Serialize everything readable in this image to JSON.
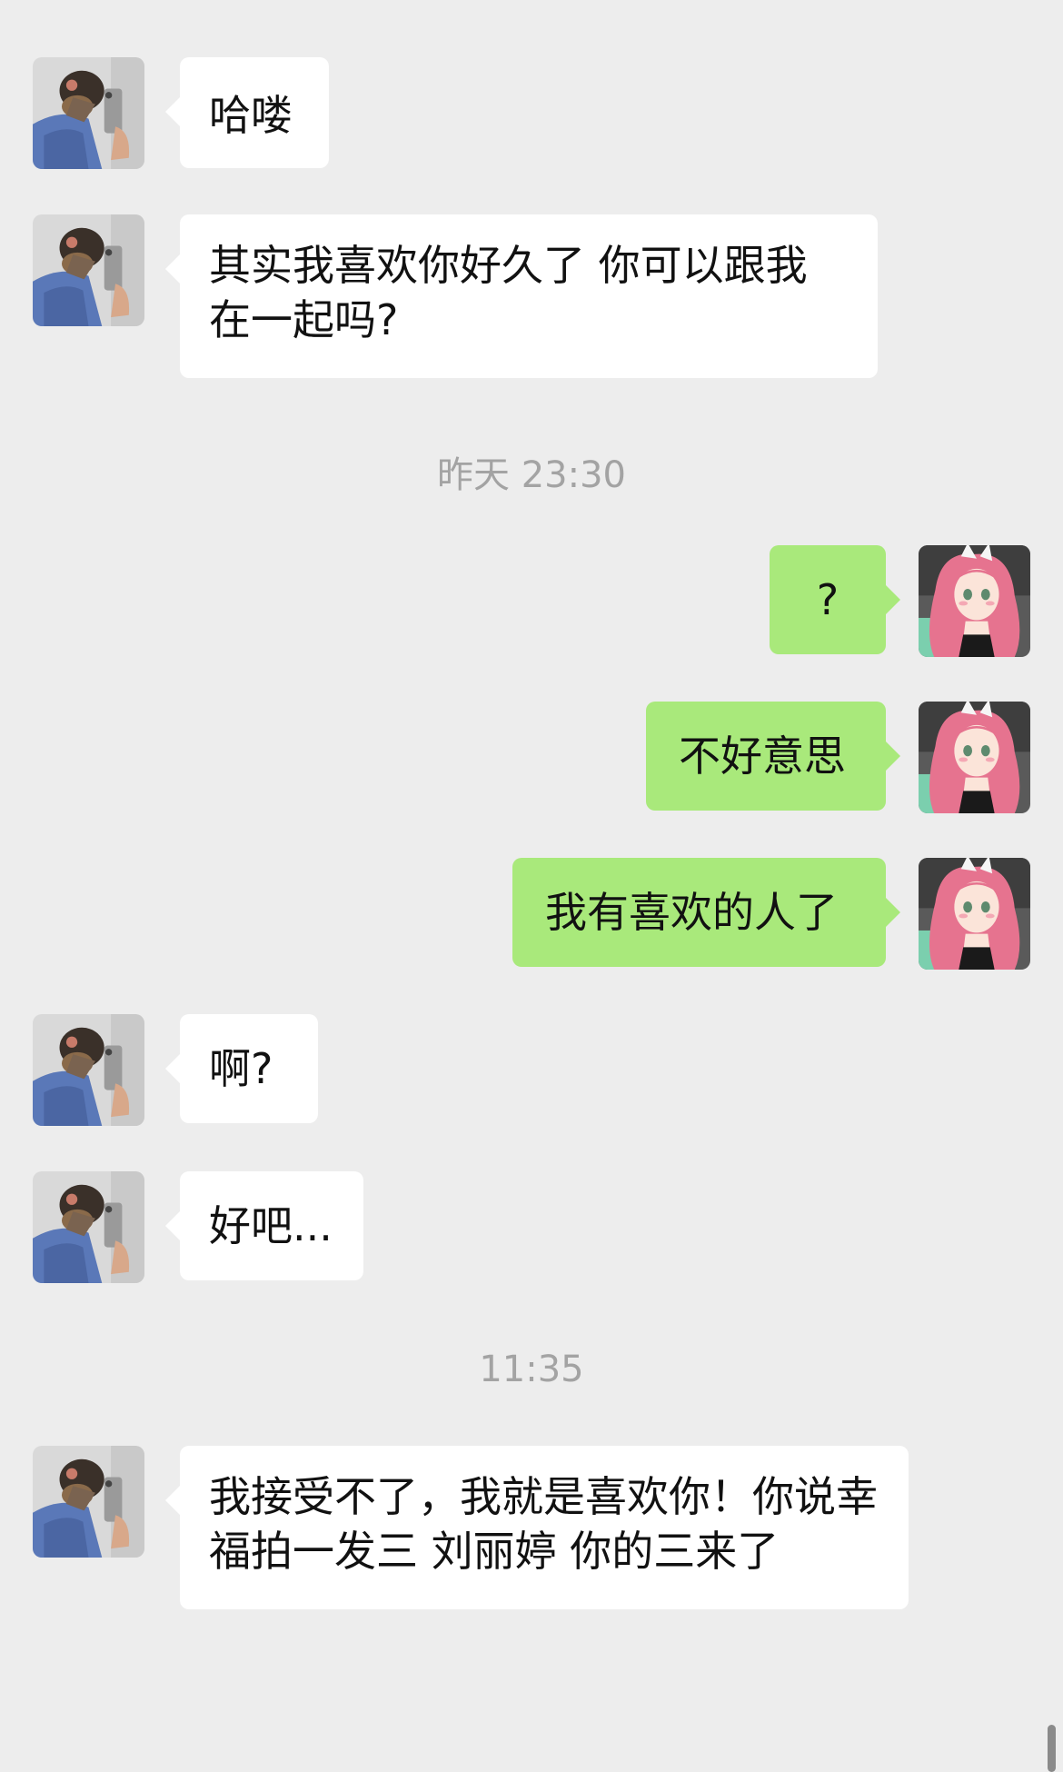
{
  "chat": {
    "messages": [
      {
        "text": "哈喽"
      },
      {
        "text": "其实我喜欢你好久了 你可以跟我在一起吗?"
      },
      {
        "text": "?"
      },
      {
        "text": "不好意思"
      },
      {
        "text": "我有喜欢的人了"
      },
      {
        "text": "啊?"
      },
      {
        "text": "好吧..."
      },
      {
        "text": "我接受不了，我就是喜欢你！你说幸福拍一发三 刘丽婷 你的三来了"
      }
    ],
    "timestamps": [
      "昨天 23:30",
      "11:35"
    ]
  },
  "colors": {
    "background": "#ededed",
    "incoming_bubble": "#ffffff",
    "outgoing_bubble": "#a9e97b",
    "timestamp_text": "#a3a3a3"
  }
}
